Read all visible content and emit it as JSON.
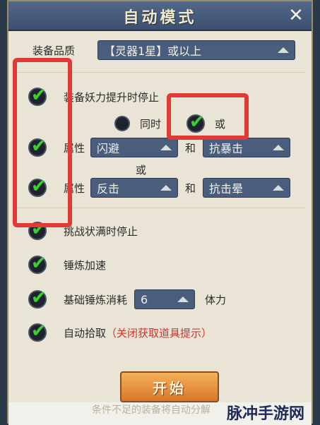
{
  "dialog": {
    "title": "自动模式",
    "close_icon": "✕"
  },
  "quality": {
    "label": "装备品质",
    "value": "【灵器1星】或以上"
  },
  "stop_upgrade": {
    "label": "装备妖力提升时停止",
    "radio_same_time": "同时",
    "radio_or": "或",
    "attr1_prefix": "属性",
    "attr1_value": "闪避",
    "and1": "和",
    "attr1_value2": "抗暴击",
    "or_between": "或",
    "attr2_prefix": "属性",
    "attr2_value": "反击",
    "and2": "和",
    "attr2_value2": "抗击晕"
  },
  "options": {
    "challenge_full_stop": "挑战状满时停止",
    "refine_speed": "锤炼加速",
    "base_refine_cost_label": "基础锤炼消耗",
    "base_refine_cost_value": "6",
    "base_refine_cost_unit": "体力",
    "auto_pickup": "自动拾取",
    "auto_pickup_note": "（关闭获取道具提示）"
  },
  "actions": {
    "start": "开始"
  },
  "footer": {
    "note": "条件不足的装备将自动分解",
    "watermark": "脉冲手游网"
  },
  "colors": {
    "accent_red": "#e23a36",
    "check_green": "#3ccf2c",
    "dropdown_bg": "#4a5d7c"
  }
}
